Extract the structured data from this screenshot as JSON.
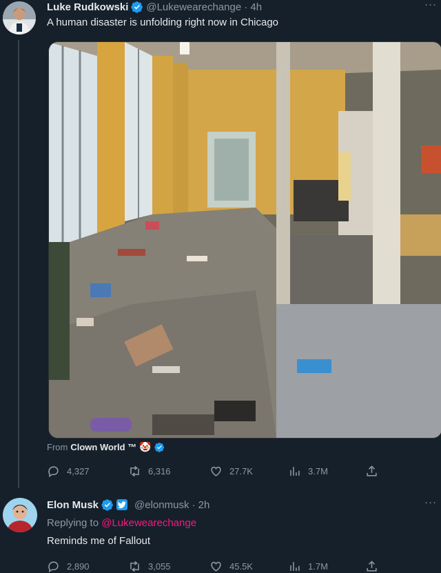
{
  "tweet1": {
    "author_name": "Luke Rudkowski",
    "author_handle": "@Lukewearechange",
    "time": "· 4h",
    "text": "A human disaster is unfolding right now in Chicago",
    "from_label": "From",
    "from_name": "Clown World ™",
    "stats": {
      "replies": "4,327",
      "retweets": "6,316",
      "likes": "27.7K",
      "views": "3.7M"
    }
  },
  "tweet2": {
    "author_name": "Elon Musk",
    "author_handle": "@elonmusk",
    "time": "· 2h",
    "replying_label": "Replying to",
    "replying_handle": "@Lukewearechange",
    "text": "Reminds me of Fallout",
    "stats": {
      "replies": "2,890",
      "retweets": "3,055",
      "likes": "45.5K",
      "views": "1.7M"
    }
  },
  "colors": {
    "background": "#15202b",
    "verified": "#1d9bf0",
    "link": "#f91880",
    "muted": "#8b98a5"
  },
  "icons": [
    "verified-badge-icon",
    "more-icon",
    "reply-icon",
    "retweet-icon",
    "like-icon",
    "views-icon",
    "share-icon",
    "clown-emoji-icon",
    "twitter-bird-badge-icon"
  ]
}
